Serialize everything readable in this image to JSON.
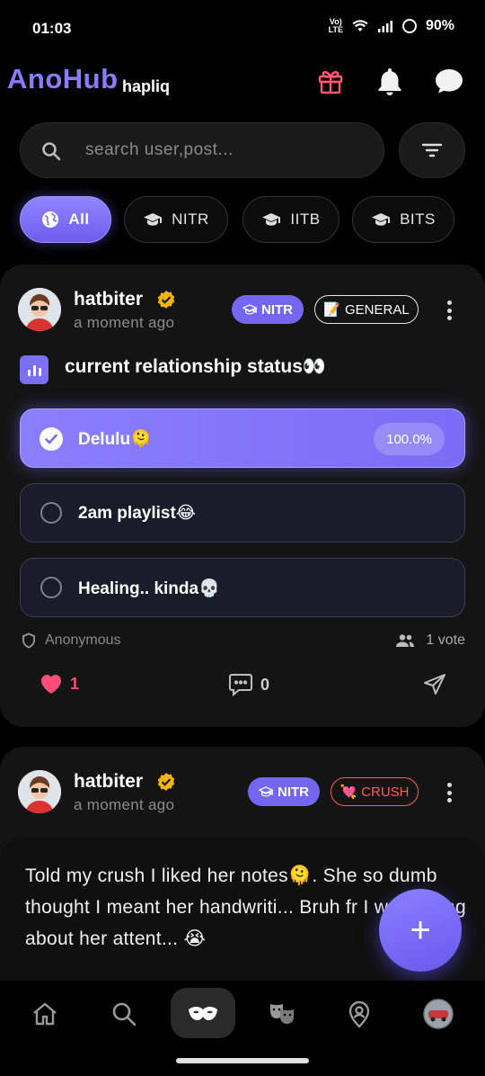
{
  "status_bar": {
    "time": "01:03",
    "net_top": "Vo)",
    "net_bottom": "LTE",
    "battery": "90%"
  },
  "header": {
    "logo": "AnoHub",
    "sub_brand": "hapliq"
  },
  "search": {
    "placeholder": "search user,post..."
  },
  "chips": [
    {
      "label": "All",
      "icon": "globe-icon",
      "active": true
    },
    {
      "label": "NITR",
      "icon": "graduation-cap-icon",
      "active": false
    },
    {
      "label": "IITB",
      "icon": "graduation-cap-icon",
      "active": false
    },
    {
      "label": "BITS",
      "icon": "graduation-cap-icon",
      "active": false
    }
  ],
  "post1": {
    "username": "hatbiter",
    "time_ago": "a moment ago",
    "college_tag": "NITR",
    "category_emoji": "📝",
    "category": "GENERAL",
    "question": "current relationship status👀",
    "options": [
      {
        "label": "Delulu🫠",
        "percent": "100.0%",
        "selected": true
      },
      {
        "label": "2am playlist😂",
        "selected": false
      },
      {
        "label": "Healing.. kinda💀",
        "selected": false
      }
    ],
    "author_type": "Anonymous",
    "votes": "1 vote",
    "likes": "1",
    "comments": "0",
    "colors": {
      "like": "#ff4d7a",
      "accent": "#7b6ff5"
    }
  },
  "post2": {
    "username": "hatbiter",
    "time_ago": "a moment ago",
    "college_tag": "NITR",
    "category_emoji": "💘",
    "category": "CRUSH",
    "text": "Told my crush I liked her notes🫠. She so dumb thought I meant her handwriti... Bruh fr I was taking about her attent... 😭",
    "colors": {
      "crush": "#ff5a5a"
    }
  },
  "fab": {
    "label": "+"
  },
  "nav": [
    "home-icon",
    "search-icon",
    "mask-icon",
    "theater-masks-icon",
    "location-pin-icon",
    "profile-avatar"
  ]
}
